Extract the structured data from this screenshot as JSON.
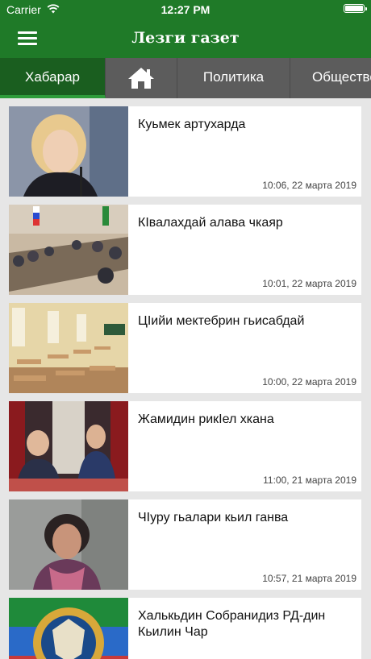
{
  "status_bar": {
    "carrier": "Carrier",
    "time": "12:27 PM"
  },
  "header": {
    "title": "Лезги газет"
  },
  "tabs": [
    {
      "label": "Хабарар",
      "active": true
    },
    {
      "label": "",
      "icon": "home-icon"
    },
    {
      "label": "Политика"
    },
    {
      "label": "Общество"
    }
  ],
  "articles": [
    {
      "title": "Куьмек артухарда",
      "date": "10:06, 22 марта 2019"
    },
    {
      "title": "КІвалахдай алава чкаяр",
      "date": "10:01, 22 марта 2019"
    },
    {
      "title": "ЦІийи мектебрин гьисабдай",
      "date": "10:00, 22 марта 2019"
    },
    {
      "title": "Жамидин рикІел хкана",
      "date": "11:00, 21 марта 2019"
    },
    {
      "title": "ЧІуру гьалари кьил ганва",
      "date": "10:57, 21 марта 2019"
    },
    {
      "title": "Халькьдин Собранидиз РД-дин Кьилин Чар",
      "date": ""
    }
  ],
  "colors": {
    "header": "#1f7a28",
    "tabs": "#5c5c5c",
    "active_tab": "#1a5e1f",
    "active_underline": "#2e9c3a",
    "background": "#e6e6e6"
  }
}
